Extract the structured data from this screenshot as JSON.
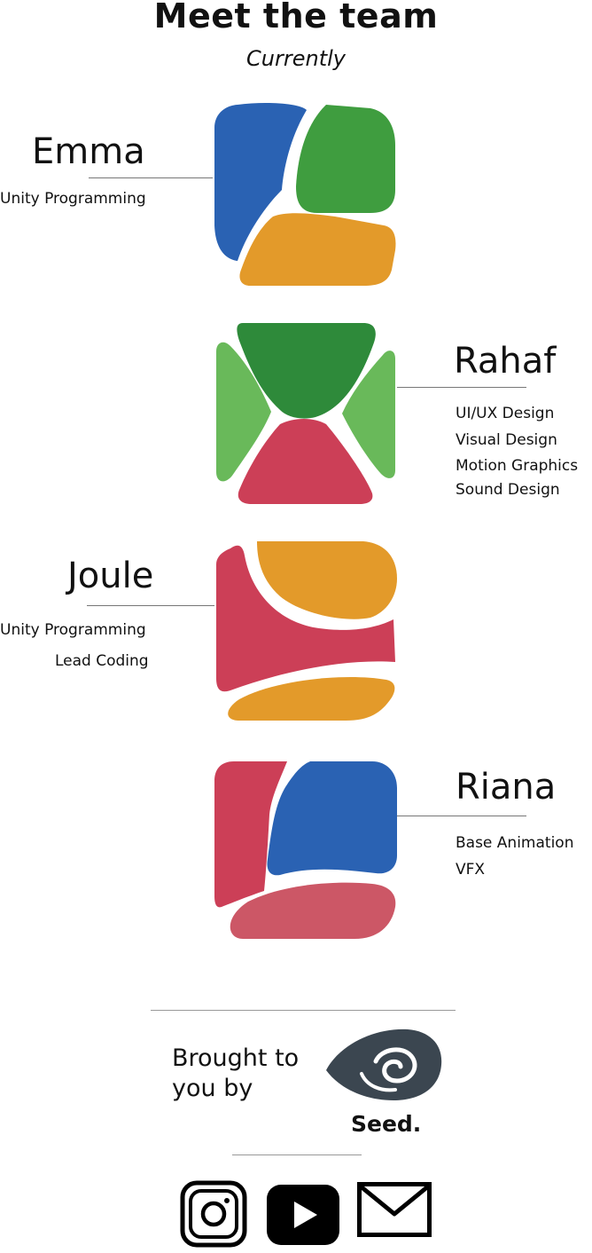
{
  "header": {
    "title": "Meet the team",
    "subtitle": "Currently"
  },
  "team": [
    {
      "name": "Emma",
      "roles": [
        "Unity Programming"
      ]
    },
    {
      "name": "Rahaf",
      "roles": [
        "UI/UX Design",
        "Visual Design",
        "Motion Graphics",
        "Sound Design"
      ]
    },
    {
      "name": "Joule",
      "roles": [
        "Unity Programming",
        "Lead Coding"
      ]
    },
    {
      "name": "Riana",
      "roles": [
        "Base Animation",
        "VFX"
      ]
    }
  ],
  "colors": {
    "blue": "#2a62b3",
    "green": "#3f9d3f",
    "orange": "#e39a2a",
    "red": "#cc3f57",
    "light_green": "#69b95a",
    "dark": "#3b4650"
  },
  "footer": {
    "brought_line1": "Brought to",
    "brought_line2": "you by",
    "brand": "Seed."
  },
  "social": [
    {
      "icon": "instagram-icon"
    },
    {
      "icon": "youtube-icon"
    },
    {
      "icon": "mail-icon"
    }
  ]
}
